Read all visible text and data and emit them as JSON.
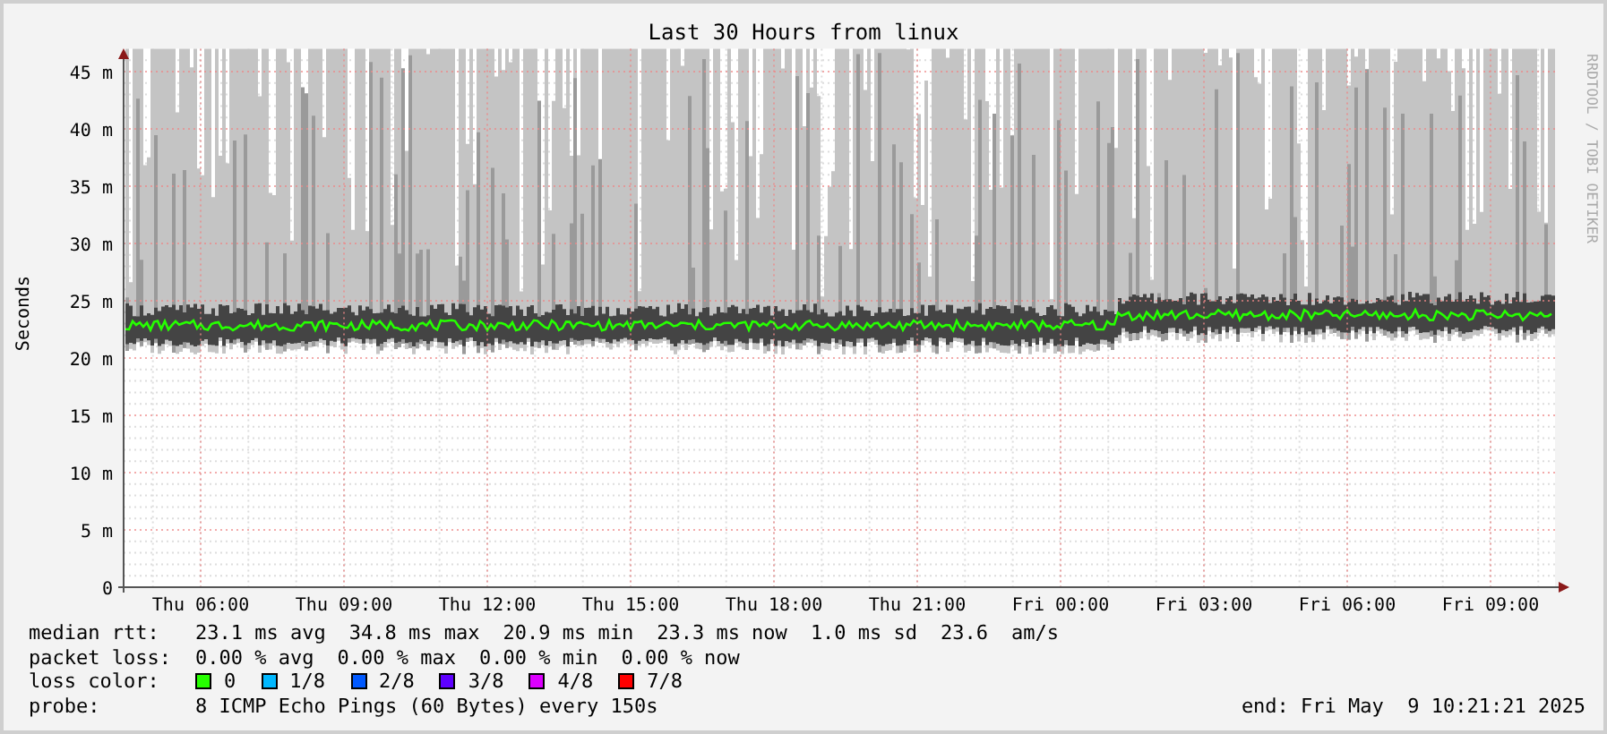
{
  "title": "Last 30 Hours from linux",
  "y_axis_label": "Seconds",
  "credit": "RRDTOOL / TOBI OETIKER",
  "y_ticks": [
    "45 m",
    "40 m",
    "35 m",
    "30 m",
    "25 m",
    "20 m",
    "15 m",
    "10 m",
    "5 m",
    "0"
  ],
  "x_ticks": [
    "Thu 06:00",
    "Thu 09:00",
    "Thu 12:00",
    "Thu 15:00",
    "Thu 18:00",
    "Thu 21:00",
    "Fri 00:00",
    "Fri 03:00",
    "Fri 06:00",
    "Fri 09:00"
  ],
  "legend": [
    {
      "label": "median rtt:",
      "items": [
        "23.1 ms avg",
        "34.8 ms max",
        "20.9 ms min",
        "23.3 ms now",
        "1.0 ms sd",
        "23.6",
        "am/s"
      ]
    },
    {
      "label": "packet loss:",
      "items": [
        "0.00 % avg",
        "0.00 % max",
        "0.00 % min",
        "0.00 % now"
      ]
    }
  ],
  "loss_color": {
    "label": "loss color:",
    "items": [
      {
        "label": "0",
        "color": "#26ff00"
      },
      {
        "label": "1/8",
        "color": "#00b8ff"
      },
      {
        "label": "2/8",
        "color": "#0059ff"
      },
      {
        "label": "3/8",
        "color": "#5e00ff"
      },
      {
        "label": "4/8",
        "color": "#dd00ff"
      },
      {
        "label": "7/8",
        "color": "#ff0000"
      }
    ]
  },
  "probe": {
    "label": "probe:",
    "value": "8 ICMP Echo Pings (60 Bytes) every 150s"
  },
  "end": "end: Fri May  9 10:21:21 2025"
}
